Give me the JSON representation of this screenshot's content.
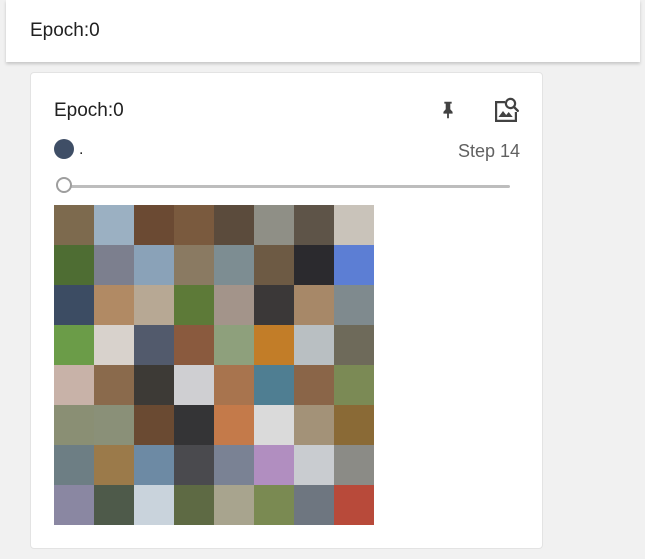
{
  "header": {
    "title": "Epoch:0"
  },
  "card": {
    "title": "Epoch:0",
    "pin_icon": "pin-icon",
    "fullscreen_icon": "image-search-icon",
    "run": {
      "label": ".",
      "color": "#3f4e66"
    },
    "step_label": "Step 14",
    "slider_value": 0,
    "image_grid": {
      "rows": 8,
      "cols": 8,
      "tile_colors": [
        "#7d6a4e",
        "#9bb0c2",
        "#6b4a33",
        "#7a5a3e",
        "#5b4b3c",
        "#8f8f86",
        "#5e5448",
        "#c9c3ba",
        "#4e6d33",
        "#7c7f8e",
        "#8aa2b8",
        "#8a7a62",
        "#7d8d92",
        "#6d5a44",
        "#2b2a2e",
        "#5c7ed4",
        "#3c4c63",
        "#b18a64",
        "#b7a894",
        "#5d7a38",
        "#a3948a",
        "#3b3838",
        "#a78868",
        "#7f8a8e",
        "#6b9c48",
        "#d8d2cc",
        "#525a6c",
        "#8a5a3e",
        "#8ea07c",
        "#c27d28",
        "#b9bfc2",
        "#6e6a5a",
        "#c8b2a8",
        "#8a6a4c",
        "#3d3a36",
        "#cfcfd2",
        "#a8744e",
        "#4f7e92",
        "#8a6548",
        "#7b8a55",
        "#8a8f74",
        "#8a9078",
        "#6a4a32",
        "#343436",
        "#c47a4a",
        "#dadada",
        "#a39278",
        "#8a6a36",
        "#6d7e84",
        "#9b7a4a",
        "#6d8aa4",
        "#4a4a4e",
        "#7a8294",
        "#b18ec0",
        "#c9ccd0",
        "#8b8b86",
        "#8a87a2",
        "#4e5a4a",
        "#c9d3dc",
        "#5e6a44",
        "#a8a48e",
        "#7a8a52",
        "#6e7680",
        "#b84a3a"
      ]
    }
  }
}
